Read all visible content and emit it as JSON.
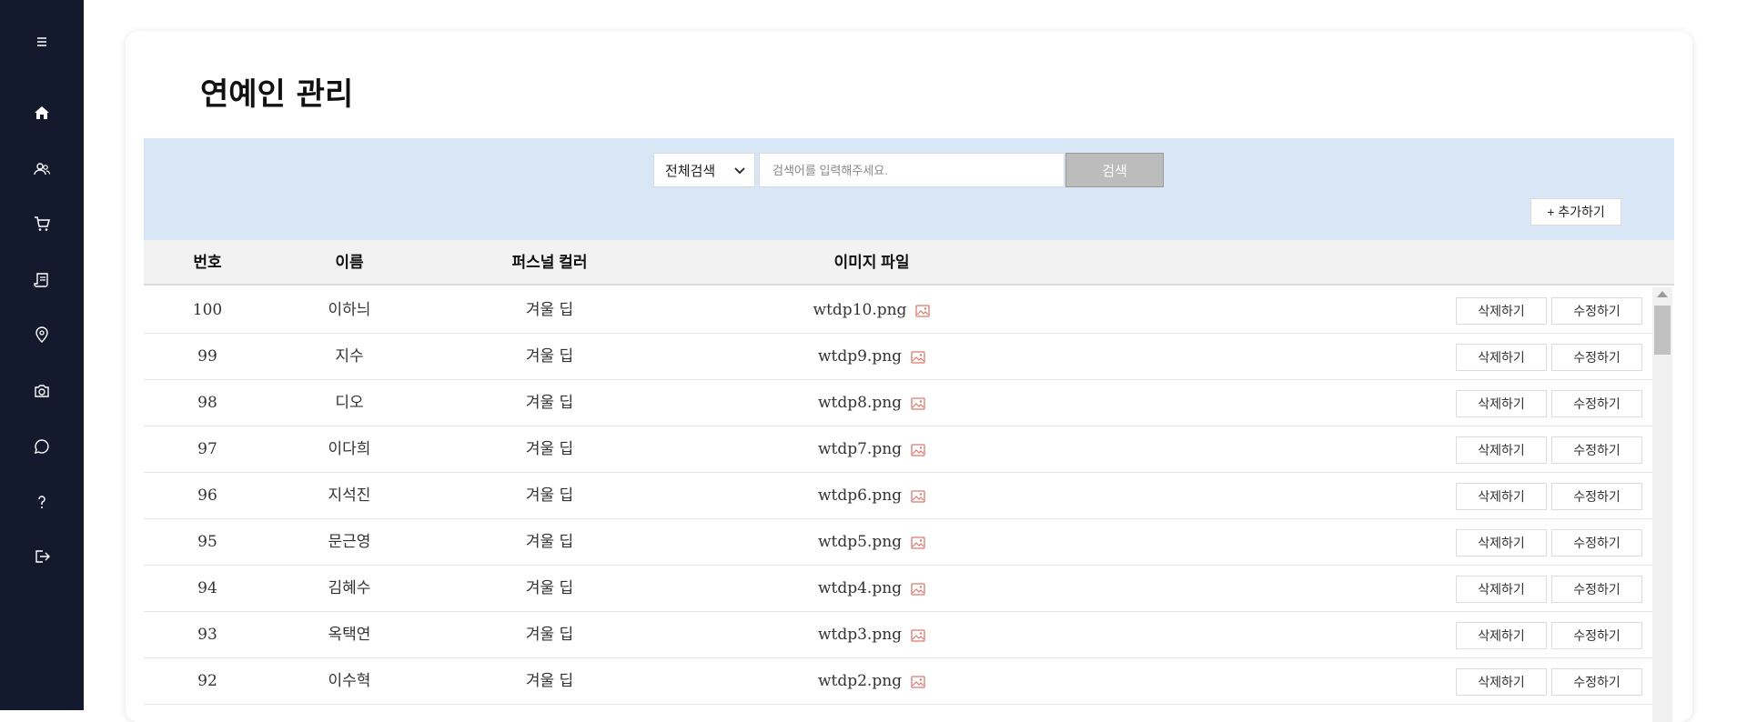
{
  "page": {
    "title": "연예인 관리"
  },
  "sidebar": {
    "items": [
      {
        "icon": "menu-icon"
      },
      {
        "icon": "home-icon"
      },
      {
        "icon": "users-icon"
      },
      {
        "icon": "cart-icon"
      },
      {
        "icon": "receipt-icon"
      },
      {
        "icon": "location-pin-icon"
      },
      {
        "icon": "camera-icon"
      },
      {
        "icon": "chat-icon"
      },
      {
        "icon": "help-icon"
      },
      {
        "icon": "logout-icon"
      }
    ]
  },
  "search": {
    "select_value": "전체검색",
    "placeholder": "검색어를 입력해주세요.",
    "button_label": "검색",
    "add_label": "+ 추가하기"
  },
  "table": {
    "headers": {
      "number": "번호",
      "name": "이름",
      "color": "퍼스널 컬러",
      "file": "이미지 파일"
    },
    "delete_label": "삭제하기",
    "edit_label": "수정하기",
    "rows": [
      {
        "number": "100",
        "name": "이하늬",
        "color": "겨울 딥",
        "file": "wtdp10.png"
      },
      {
        "number": "99",
        "name": "지수",
        "color": "겨울 딥",
        "file": "wtdp9.png"
      },
      {
        "number": "98",
        "name": "디오",
        "color": "겨울 딥",
        "file": "wtdp8.png"
      },
      {
        "number": "97",
        "name": "이다희",
        "color": "겨울 딥",
        "file": "wtdp7.png"
      },
      {
        "number": "96",
        "name": "지석진",
        "color": "겨울 딥",
        "file": "wtdp6.png"
      },
      {
        "number": "95",
        "name": "문근영",
        "color": "겨울 딥",
        "file": "wtdp5.png"
      },
      {
        "number": "94",
        "name": "김혜수",
        "color": "겨울 딥",
        "file": "wtdp4.png"
      },
      {
        "number": "93",
        "name": "옥택연",
        "color": "겨울 딥",
        "file": "wtdp3.png"
      },
      {
        "number": "92",
        "name": "이수혁",
        "color": "겨울 딥",
        "file": "wtdp2.png"
      }
    ]
  },
  "colors": {
    "sidebar_bg": "#141a2e",
    "search_panel_bg": "#d9e6f6",
    "image_icon": "#d9796f"
  }
}
